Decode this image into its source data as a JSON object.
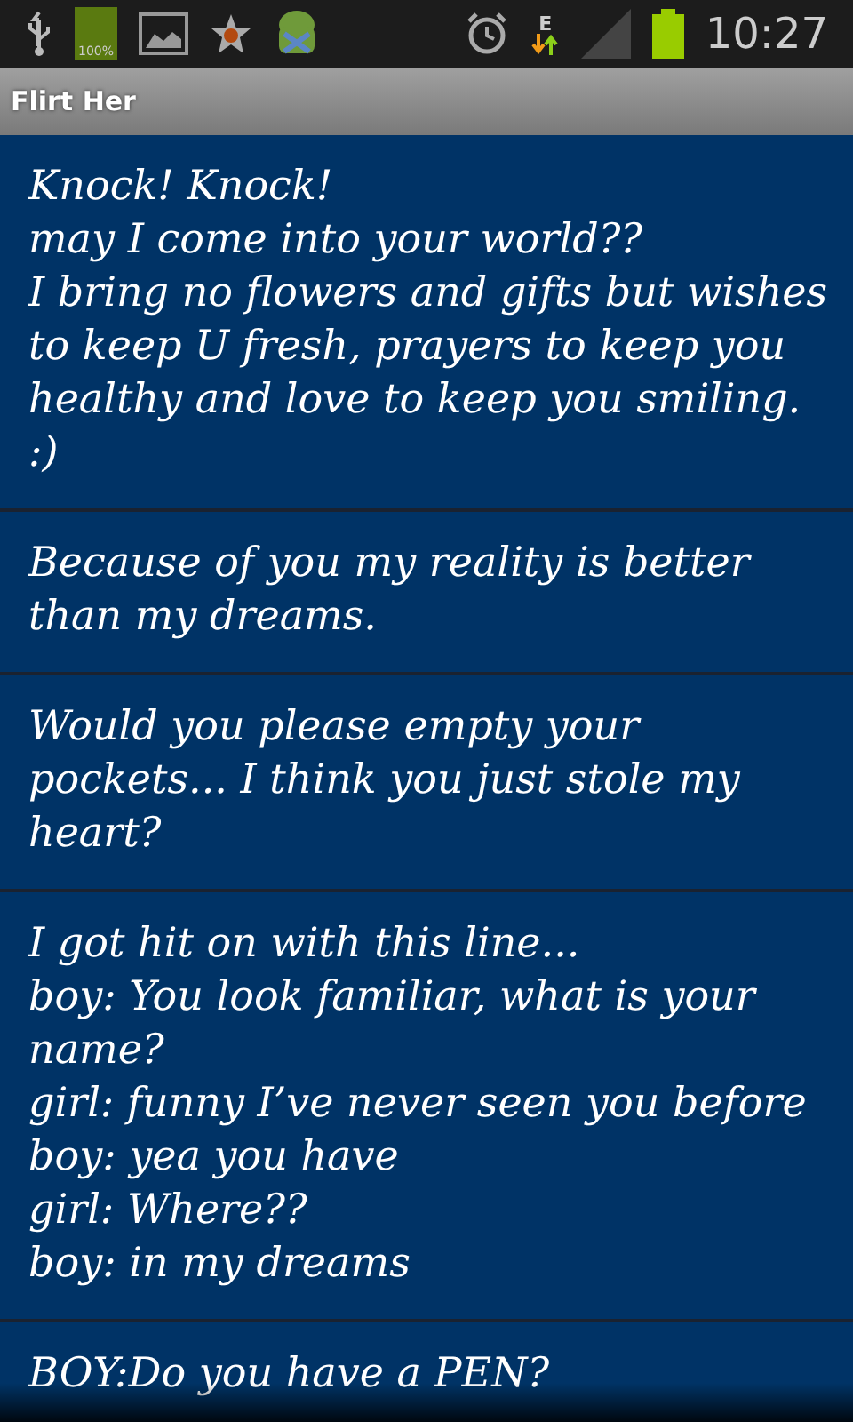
{
  "status_bar": {
    "battery_label": "100%",
    "network": "E",
    "time": "10:27"
  },
  "title_bar": {
    "title": "Flirt Her"
  },
  "messages": [
    {
      "text": "Knock! Knock!\nmay I come into your world??\nI bring no flowers and gifts but wishes to keep U fresh, prayers to keep you healthy and love to keep you smiling. :)"
    },
    {
      "text": "Because of you my reality is better than my dreams."
    },
    {
      "text": "Would you please empty your pockets... I think you just stole my heart?"
    },
    {
      "text": "I got hit on with this line...\nboy: You look familiar, what is your name?\ngirl: funny I’ve never seen you before\nboy: yea you have\ngirl: Where??\nboy: in my dreams"
    },
    {
      "text": "BOY:Do you have a PEN?"
    }
  ]
}
